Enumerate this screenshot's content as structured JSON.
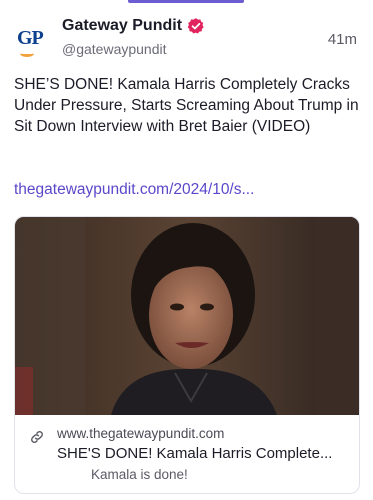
{
  "post": {
    "author_name": "Gateway Pundit",
    "author_handle": "@gatewaypundit",
    "avatar_text": "GP",
    "timestamp": "41m",
    "text": "SHE’S DONE! Kamala Harris Completely Cracks Under Pressure, Starts Screaming About Trump in Sit Down Interview with Bret Baier (VIDEO)",
    "link_text": "thegatewaypundit.com/2024/10/s..."
  },
  "link_card": {
    "domain": "www.thegatewaypundit.com",
    "title": "SHE'S DONE! Kamala Harris Complete...",
    "description": "Kamala is done!",
    "icon": "link-icon"
  },
  "colors": {
    "accent": "#5b48c9",
    "verified": "#e0245e",
    "tab_indicator": "#6c5dd3"
  }
}
